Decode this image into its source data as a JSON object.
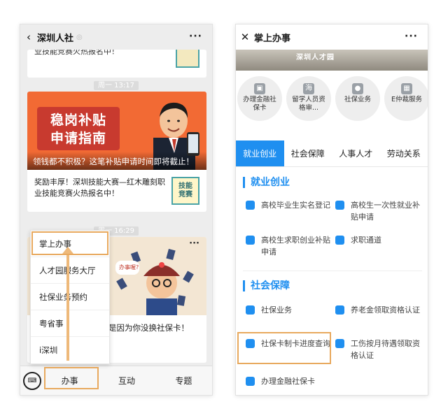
{
  "left": {
    "title": "深圳人社",
    "top_card_text": "业技能竞赛火热报名中！",
    "top_card_logo": "技能",
    "time1": "周一 13:17",
    "card1": {
      "banner_title_line1": "稳岗补贴",
      "banner_title_line2": "申请指南",
      "banner_caption": "领钱都不积极？这笔补贴申请时间即将截止！",
      "body": "奖励丰厚！深圳技能大赛—红木雕刻职业技能竞赛火热报名中！",
      "logo_line1": "技能",
      "logo_line2": "竞赛"
    },
    "time2": "周一 16:29",
    "card2": {
      "caption": "是因为你没换社保卡！",
      "bubble": "办事喔?"
    },
    "menu": [
      "掌上办事",
      "人才园服务大厅",
      "社保业务预约",
      "粤省事",
      "i深圳"
    ],
    "bottom_tabs": [
      "办事",
      "互动",
      "专题"
    ]
  },
  "right": {
    "title": "掌上办事",
    "photo_text": "深圳人才园",
    "circles": [
      {
        "label": "办理金融社保卡",
        "icon": "▣"
      },
      {
        "label": "留学人员资格审...",
        "icon": "海"
      },
      {
        "label": "社保业务",
        "icon": "●"
      },
      {
        "label": "E仲裁服务",
        "icon": "▦"
      }
    ],
    "tabs": [
      "就业创业",
      "社会保障",
      "人事人才",
      "劳动关系"
    ],
    "section1": {
      "title": "就业创业",
      "items": [
        "高校毕业生实名登记",
        "高校生一次性就业补贴申请",
        "高校生求职创业补贴申请",
        "求职通道"
      ]
    },
    "section2": {
      "title": "社会保障",
      "items": [
        "社保业务",
        "养老金领取资格认证",
        "社保卡制卡进度查询",
        "工伤按月待遇领取资格认证",
        "办理金融社保卡"
      ]
    }
  },
  "colors": {
    "accent_blue": "#1f8ff0",
    "highlight_orange": "#e8a95e",
    "banner_orange": "#f26a34"
  }
}
